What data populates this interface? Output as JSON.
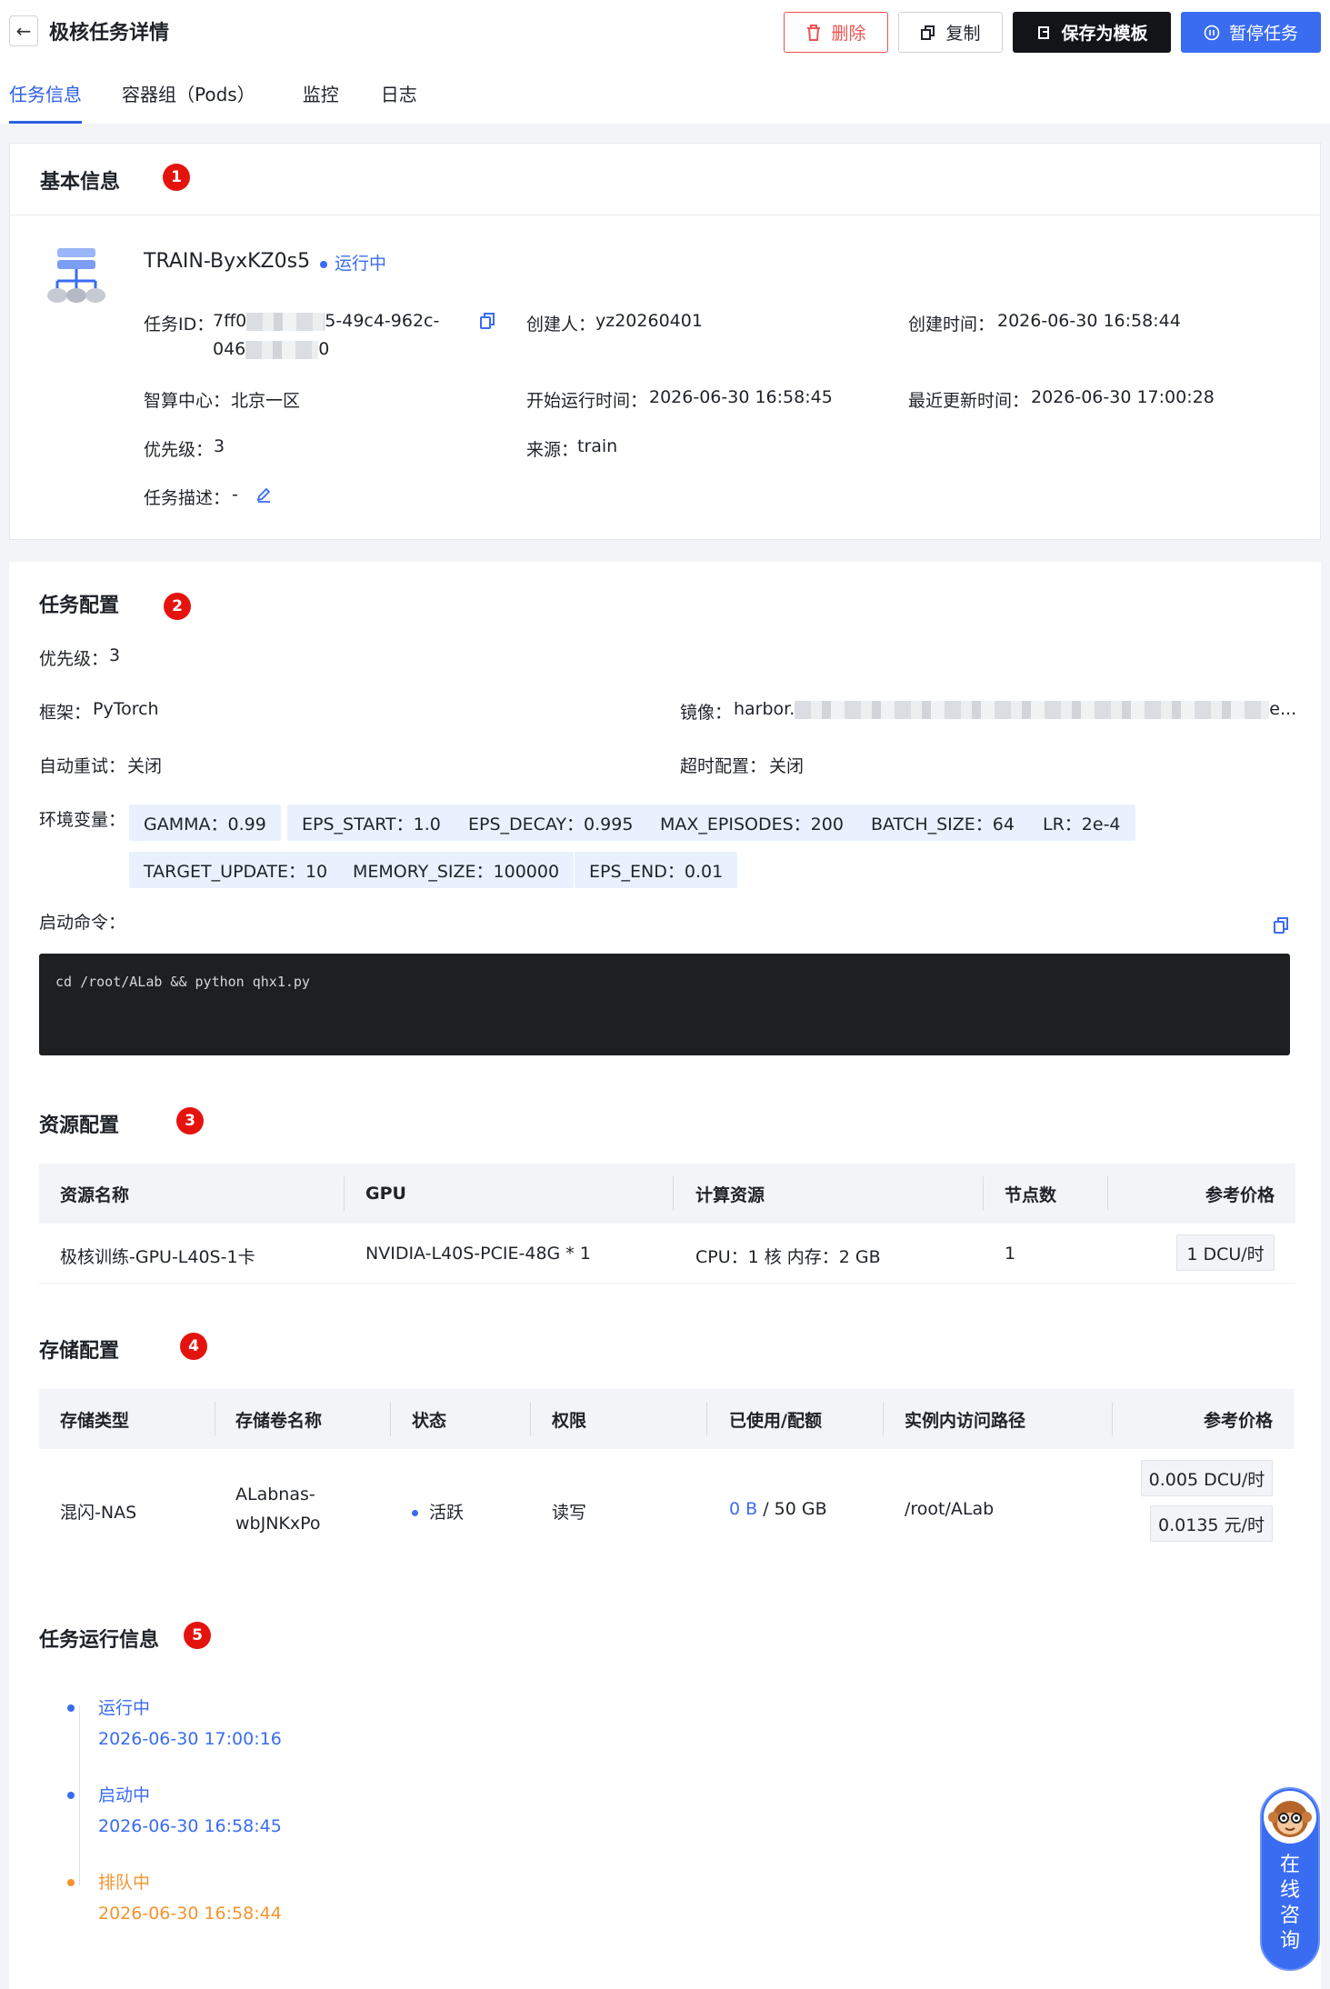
{
  "header": {
    "back_icon": "arrow-left-icon",
    "title": "极核任务详情",
    "buttons": {
      "delete": "删除",
      "copy": "复制",
      "save_template": "保存为模板",
      "pause": "暂停任务"
    }
  },
  "tabs": [
    {
      "label": "任务信息",
      "active": true
    },
    {
      "label": "容器组（Pods）",
      "active": false
    },
    {
      "label": "监控",
      "active": false
    },
    {
      "label": "日志",
      "active": false
    }
  ],
  "basic_info": {
    "section_title": "基本信息",
    "badge": "1",
    "task_name": "TRAIN-ByxKZ0s5",
    "status": "运行中",
    "task_id_label": "任务ID：",
    "task_id_line1_start": "7ff0",
    "task_id_line1_end": "5-49c4-962c-",
    "task_id_line2_start": "046",
    "task_id_line2_end": "0",
    "creator_label": "创建人：",
    "creator": "yz20260401",
    "create_time_label": "创建时间：",
    "create_time": "2026-06-30 16:58:44",
    "center_label": "智算中心：",
    "center": "北京一区",
    "start_time_label": "开始运行时间：",
    "start_time": "2026-06-30 16:58:45",
    "update_time_label": "最近更新时间：",
    "update_time": "2026-06-30 17:00:28",
    "priority_label": "优先级：",
    "priority": "3",
    "source_label": "来源：",
    "source": "train",
    "desc_label": "任务描述：",
    "desc": "-"
  },
  "task_config": {
    "section_title": "任务配置",
    "badge": "2",
    "priority_label": "优先级：",
    "priority": "3",
    "framework_label": "框架：",
    "framework": "PyTorch",
    "image_label": "镜像：",
    "image_start": "harbor.",
    "image_end": "e...",
    "retry_label": "自动重试：",
    "retry": "关闭",
    "timeout_label": "超时配置：",
    "timeout": "关闭",
    "env_label": "环境变量：",
    "env_row1": [
      "GAMMA：0.99",
      "EPS_START：1.0",
      "EPS_DECAY：0.995",
      "MAX_EPISODES：200",
      "BATCH_SIZE：64",
      "LR：2e-4"
    ],
    "env_row2": [
      "TARGET_UPDATE：10",
      "MEMORY_SIZE：100000",
      "EPS_END：0.01"
    ],
    "cmd_label": "启动命令：",
    "cmd": "cd  /root/ALab &&  python qhx1.py"
  },
  "resource_config": {
    "section_title": "资源配置",
    "badge": "3",
    "columns": [
      "资源名称",
      "GPU",
      "计算资源",
      "节点数",
      "参考价格"
    ],
    "row": {
      "name": "极核训练-GPU-L40S-1卡",
      "gpu": "NVIDIA-L40S-PCIE-48G * 1",
      "compute": "CPU：1 核  内存：2 GB",
      "nodes": "1",
      "price": "1 DCU/时"
    }
  },
  "storage_config": {
    "section_title": "存储配置",
    "badge": "4",
    "columns": [
      "存储类型",
      "存储卷名称",
      "状态",
      "权限",
      "已使用/配额",
      "实例内访问路径",
      "参考价格"
    ],
    "row": {
      "type": "混闪-NAS",
      "volume_line1": "ALabnas-",
      "volume_line2": "wbJNKxPo",
      "status": "活跃",
      "permission": "读写",
      "used": "0 B",
      "quota": " / 50 GB",
      "path": "/root/ALab",
      "price1": "0.005 DCU/时",
      "price2": "0.0135 元/时"
    }
  },
  "run_info": {
    "section_title": "任务运行信息",
    "badge": "5",
    "events": [
      {
        "status": "运行中",
        "time": "2026-06-30 17:00:16",
        "color": "#3a6cf2"
      },
      {
        "status": "启动中",
        "time": "2026-06-30 16:58:45",
        "color": "#3a6cf2"
      },
      {
        "status": "排队中",
        "time": "2026-06-30 16:58:44",
        "color": "#f5932f"
      }
    ]
  },
  "consult": {
    "label_chars": [
      "在",
      "线",
      "咨",
      "询"
    ]
  },
  "colors": {
    "primary": "#3a6cf2",
    "danger": "#f05050",
    "badge_red": "#e5130e",
    "warning": "#f5932f"
  }
}
